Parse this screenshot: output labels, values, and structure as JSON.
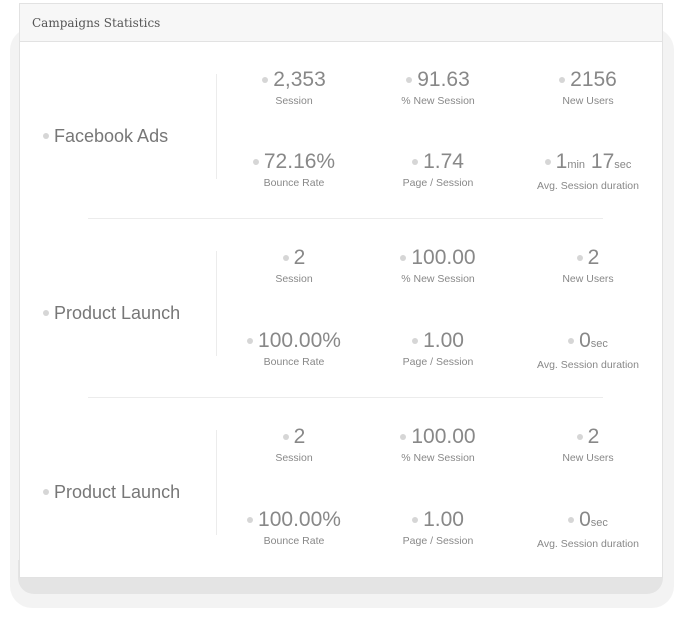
{
  "card": {
    "title": "Campaigns Statistics"
  },
  "campaigns": [
    {
      "name": "Facebook Ads",
      "metrics": {
        "session": {
          "value": "2,353",
          "label": "Session"
        },
        "new_session_pct": {
          "value": "91.63",
          "label": "% New Session"
        },
        "new_users": {
          "value": "2156",
          "label": "New Users"
        },
        "bounce_rate": {
          "value": "72.16%",
          "label": "Bounce Rate"
        },
        "page_session": {
          "value": "1.74",
          "label": "Page / Session"
        },
        "avg_duration": {
          "min": "1",
          "min_unit": "min",
          "sec": "17",
          "sec_unit": "sec",
          "label": "Avg. Session duration"
        }
      }
    },
    {
      "name": "Product Launch",
      "metrics": {
        "session": {
          "value": "2",
          "label": "Session"
        },
        "new_session_pct": {
          "value": "100.00",
          "label": "% New Session"
        },
        "new_users": {
          "value": "2",
          "label": "New Users"
        },
        "bounce_rate": {
          "value": "100.00%",
          "label": "Bounce Rate"
        },
        "page_session": {
          "value": "1.00",
          "label": "Page / Session"
        },
        "avg_duration": {
          "sec": "0",
          "sec_unit": "sec",
          "label": "Avg. Session duration"
        }
      }
    },
    {
      "name": "Product Launch",
      "metrics": {
        "session": {
          "value": "2",
          "label": "Session"
        },
        "new_session_pct": {
          "value": "100.00",
          "label": "% New Session"
        },
        "new_users": {
          "value": "2",
          "label": "New Users"
        },
        "bounce_rate": {
          "value": "100.00%",
          "label": "Bounce Rate"
        },
        "page_session": {
          "value": "1.00",
          "label": "Page / Session"
        },
        "avg_duration": {
          "sec": "0",
          "sec_unit": "sec",
          "label": "Avg. Session duration"
        }
      }
    }
  ],
  "colors": {
    "text": "#888888",
    "bullet": "#d6d6d6",
    "header_bg": "#f7f7f7",
    "border": "#e2e2e2"
  }
}
